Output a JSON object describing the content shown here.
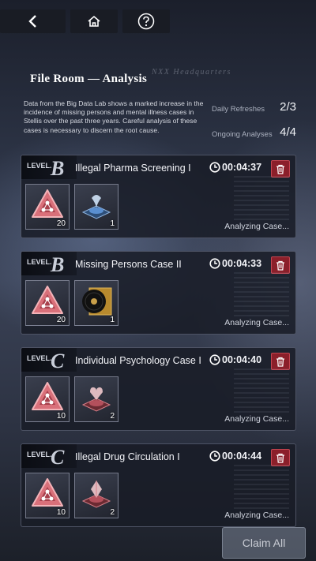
{
  "header": {
    "title": "File Room — Analysis",
    "subtitle": "NXX Headquarters",
    "description": "Data from the Big Data Lab shows a marked increase in the incidence of missing persons and mental illness cases in Stellis over the past three years. Careful analysis of these cases is necessary to discern the root cause."
  },
  "stats": {
    "daily_refreshes_label": "Daily Refreshes",
    "daily_refreshes_value": "2/3",
    "ongoing_analyses_label": "Ongoing Analyses",
    "ongoing_analyses_value": "4/4"
  },
  "level_word": "LEVEL.",
  "cases": [
    {
      "level": "B",
      "title": "Illegal Pharma Screening I",
      "timer": "00:04:37",
      "items": [
        {
          "icon": "triangle-seal-icon",
          "qty": "20"
        },
        {
          "icon": "blue-hologram-icon",
          "qty": "1"
        }
      ],
      "status": "Analyzing Case..."
    },
    {
      "level": "B",
      "title": "Missing Persons Case II",
      "timer": "00:04:33",
      "items": [
        {
          "icon": "triangle-seal-icon",
          "qty": "20"
        },
        {
          "icon": "vinyl-record-icon",
          "qty": "1"
        }
      ],
      "status": "Analyzing Case..."
    },
    {
      "level": "C",
      "title": "Individual Psychology Case I",
      "timer": "00:04:40",
      "items": [
        {
          "icon": "triangle-seal-icon",
          "qty": "10"
        },
        {
          "icon": "red-heart-hologram-icon",
          "qty": "2"
        }
      ],
      "status": "Analyzing Case..."
    },
    {
      "level": "C",
      "title": "Illegal Drug Circulation I",
      "timer": "00:04:44",
      "items": [
        {
          "icon": "triangle-seal-icon",
          "qty": "10"
        },
        {
          "icon": "red-diamond-hologram-icon",
          "qty": "2"
        }
      ],
      "status": "Analyzing Case..."
    }
  ],
  "claim_all_label": "Claim All",
  "colors": {
    "accent_red": "#8b1f2a",
    "panel": "#181c26"
  }
}
